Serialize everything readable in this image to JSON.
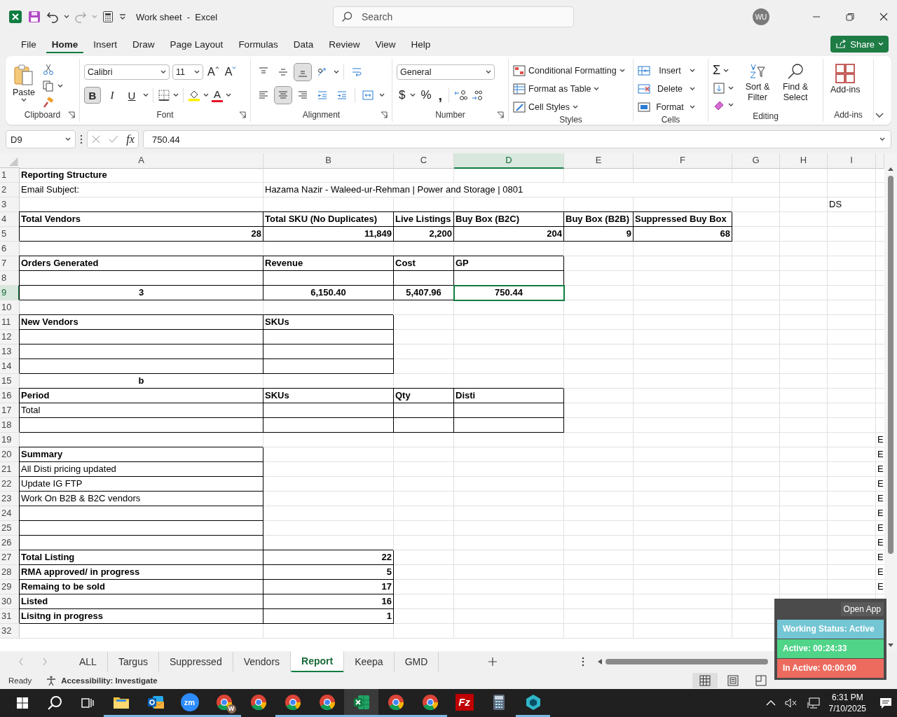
{
  "title_bar": {
    "title": "Work sheet  -  Excel",
    "search": {
      "placeholder": "Search"
    },
    "avatar": "WU"
  },
  "menu_tabs": [
    {
      "label": "File",
      "selected": false
    },
    {
      "label": "Home",
      "selected": true
    },
    {
      "label": "Insert",
      "selected": false
    },
    {
      "label": "Draw",
      "selected": false
    },
    {
      "label": "Page Layout",
      "selected": false
    },
    {
      "label": "Formulas",
      "selected": false
    },
    {
      "label": "Data",
      "selected": false
    },
    {
      "label": "Review",
      "selected": false
    },
    {
      "label": "View",
      "selected": false
    },
    {
      "label": "Help",
      "selected": false
    }
  ],
  "share": "Share",
  "ribbon": [
    {
      "kind": "clipboard",
      "label": "Clipboard",
      "paste": "Paste"
    },
    {
      "kind": "font",
      "label": "Font",
      "font": "Calibri",
      "size": "11",
      "sizers": [
        "A",
        "A"
      ],
      "styles": [
        {
          "label": "B",
          "selected": true
        },
        {
          "label": "I",
          "selected": false
        },
        {
          "label": "U",
          "selected": false
        }
      ],
      "color_letter": "A"
    },
    {
      "kind": "alignment",
      "label": "Alignment",
      "rows": [
        [
          {
            "kind": "top",
            "selected": false
          },
          {
            "kind": "middle",
            "selected": false
          },
          {
            "kind": "bottom",
            "selected": true
          },
          {
            "kind": "orientation",
            "selected": false
          },
          {
            "kind": "wrap",
            "selected": false
          }
        ],
        [
          {
            "kind": "left",
            "selected": false
          },
          {
            "kind": "center",
            "selected": true
          },
          {
            "kind": "right",
            "selected": false
          },
          {
            "kind": "outdent",
            "selected": false
          },
          {
            "kind": "indent",
            "selected": false
          },
          {
            "kind": "merge",
            "selected": false
          }
        ]
      ]
    },
    {
      "kind": "number",
      "label": "Number",
      "format": "General",
      "symbols": [
        "$",
        "%",
        ","
      ]
    },
    {
      "kind": "styles",
      "label": "Styles",
      "items": [
        "Conditional Formatting",
        "Format as Table",
        "Cell Styles"
      ]
    },
    {
      "kind": "cells",
      "label": "Cells",
      "items": [
        "Insert",
        "Delete",
        "Format"
      ]
    },
    {
      "kind": "editing",
      "label": "Editing",
      "sum": "Σ",
      "buttons": [
        "Sort & Filter",
        "Find & Select"
      ]
    },
    {
      "kind": "addins",
      "label": "Add-ins",
      "button": "Add-ins"
    }
  ],
  "formula_bar": {
    "name_box": "D9",
    "fx": "fx",
    "value": "750.44"
  },
  "columns": [
    {
      "label": "A",
      "selected": false
    },
    {
      "label": "B",
      "selected": false
    },
    {
      "label": "C",
      "selected": false
    },
    {
      "label": "D",
      "selected": true
    },
    {
      "label": "E",
      "selected": false
    },
    {
      "label": "F",
      "selected": false
    },
    {
      "label": "G",
      "selected": false
    },
    {
      "label": "H",
      "selected": false
    },
    {
      "label": "I",
      "selected": false
    }
  ],
  "rows": [
    {
      "num": "1",
      "selected": false,
      "A": {
        "text": "Reporting Structure",
        "bold": true,
        "selected": false
      }
    },
    {
      "num": "2",
      "selected": false,
      "A": {
        "text": "Email Subject:",
        "selected": false
      },
      "B": {
        "text": "Hazama Nazir - Waleed-ur-Rehman | Power and Storage | 0801",
        "overflow": true,
        "selected": false
      }
    },
    {
      "num": "3",
      "selected": false,
      "I": {
        "text": "DS",
        "selected": false
      }
    },
    {
      "num": "4",
      "selected": false,
      "A": {
        "text": "Total Vendors",
        "bold": true,
        "boxed": true,
        "selected": false
      },
      "B": {
        "text": "Total SKU (No Duplicates)",
        "bold": true,
        "boxed": true,
        "selected": false
      },
      "C": {
        "text": "Live Listings",
        "bold": true,
        "boxed": true,
        "selected": false
      },
      "D": {
        "text": "Buy Box (B2C)",
        "bold": true,
        "boxed": true,
        "selected": false
      },
      "E": {
        "text": "Buy Box (B2B)",
        "bold": true,
        "boxed": true,
        "selected": false
      },
      "F": {
        "text": "Suppressed Buy Box",
        "bold": true,
        "boxed": true,
        "selected": false
      }
    },
    {
      "num": "5",
      "selected": false,
      "A": {
        "text": "28",
        "bold": true,
        "right_aligned": true,
        "boxed": true,
        "selected": false
      },
      "B": {
        "text": "11,849",
        "bold": true,
        "right_aligned": true,
        "boxed": true,
        "selected": false
      },
      "C": {
        "text": "2,200",
        "bold": true,
        "right_aligned": true,
        "boxed": true,
        "selected": false
      },
      "D": {
        "text": "204",
        "bold": true,
        "right_aligned": true,
        "boxed": true,
        "selected": false
      },
      "E": {
        "text": "9",
        "bold": true,
        "right_aligned": true,
        "boxed": true,
        "selected": false
      },
      "F": {
        "text": "68",
        "bold": true,
        "right_aligned": true,
        "boxed": true,
        "selected": false
      }
    },
    {
      "num": "6",
      "selected": false
    },
    {
      "num": "7",
      "selected": false,
      "A": {
        "text": "Orders Generated",
        "bold": true,
        "boxed": true,
        "selected": false
      },
      "B": {
        "text": "Revenue",
        "bold": true,
        "boxed": true,
        "selected": false
      },
      "C": {
        "text": "Cost",
        "bold": true,
        "boxed": true,
        "selected": false
      },
      "D": {
        "text": "GP",
        "bold": true,
        "boxed": true,
        "selected": false
      }
    },
    {
      "num": "8",
      "selected": false,
      "A": {
        "boxed": true,
        "selected": false
      },
      "B": {
        "boxed": true,
        "selected": false
      },
      "C": {
        "boxed": true,
        "selected": false
      },
      "D": {
        "boxed": true,
        "selected": false
      }
    },
    {
      "num": "9",
      "selected": true,
      "A": {
        "text": "3",
        "bold": true,
        "centered": true,
        "boxed": true,
        "selected": false
      },
      "B": {
        "text": "6,150.40",
        "bold": true,
        "centered": true,
        "boxed": true,
        "selected": false
      },
      "C": {
        "text": "5,407.96",
        "bold": true,
        "centered": true,
        "boxed": true,
        "selected": false
      },
      "D": {
        "text": "750.44",
        "bold": true,
        "centered": true,
        "boxed": true,
        "selected": true
      }
    },
    {
      "num": "10",
      "selected": false
    },
    {
      "num": "11",
      "selected": false,
      "A": {
        "text": "New Vendors",
        "bold": true,
        "boxed": true,
        "selected": false
      },
      "B": {
        "text": "SKUs",
        "bold": true,
        "boxed": true,
        "selected": false
      }
    },
    {
      "num": "12",
      "selected": false,
      "A": {
        "boxed": true,
        "selected": false
      },
      "B": {
        "boxed": true,
        "selected": false
      }
    },
    {
      "num": "13",
      "selected": false,
      "A": {
        "boxed": true,
        "selected": false
      },
      "B": {
        "boxed": true,
        "selected": false
      }
    },
    {
      "num": "14",
      "selected": false,
      "A": {
        "boxed": true,
        "selected": false
      },
      "B": {
        "boxed": true,
        "selected": false
      }
    },
    {
      "num": "15",
      "selected": false,
      "A": {
        "text": "b",
        "bold": true,
        "centered": true,
        "selected": false
      }
    },
    {
      "num": "16",
      "selected": false,
      "A": {
        "text": "Period",
        "bold": true,
        "boxed": true,
        "selected": false
      },
      "B": {
        "text": "SKUs",
        "bold": true,
        "boxed": true,
        "selected": false
      },
      "C": {
        "text": "Qty",
        "bold": true,
        "boxed": true,
        "selected": false
      },
      "D": {
        "text": "Disti",
        "bold": true,
        "boxed": true,
        "selected": false
      }
    },
    {
      "num": "17",
      "selected": false,
      "A": {
        "text": "Total",
        "boxed": true,
        "selected": false
      },
      "B": {
        "boxed": true,
        "selected": false
      },
      "C": {
        "boxed": true,
        "selected": false
      },
      "D": {
        "boxed": true,
        "selected": false
      }
    },
    {
      "num": "18",
      "selected": false,
      "A": {
        "boxed": true,
        "selected": false
      },
      "B": {
        "boxed": true,
        "selected": false
      },
      "C": {
        "boxed": true,
        "selected": false
      },
      "D": {
        "boxed": true,
        "selected": false
      }
    },
    {
      "num": "19",
      "selected": false,
      "J": {
        "text": "E",
        "selected": false
      }
    },
    {
      "num": "20",
      "selected": false,
      "A": {
        "text": "Summary",
        "bold": true,
        "boxed": true,
        "selected": false
      },
      "J": {
        "text": "E",
        "selected": false
      }
    },
    {
      "num": "21",
      "selected": false,
      "A": {
        "text": "All Disti pricing updated",
        "boxed": true,
        "selected": false
      },
      "J": {
        "text": "E",
        "selected": false
      }
    },
    {
      "num": "22",
      "selected": false,
      "A": {
        "text": "Update IG FTP",
        "boxed": true,
        "selected": false
      },
      "J": {
        "text": "E",
        "selected": false
      }
    },
    {
      "num": "23",
      "selected": false,
      "A": {
        "text": "Work On B2B & B2C vendors",
        "boxed": true,
        "selected": false
      },
      "J": {
        "text": "E",
        "selected": false
      }
    },
    {
      "num": "24",
      "selected": false,
      "A": {
        "boxed": true,
        "selected": false
      },
      "J": {
        "text": "E",
        "selected": false
      }
    },
    {
      "num": "25",
      "selected": false,
      "A": {
        "boxed": true,
        "selected": false
      },
      "J": {
        "text": "E",
        "selected": false
      }
    },
    {
      "num": "26",
      "selected": false,
      "A": {
        "boxed": true,
        "selected": false
      },
      "J": {
        "text": "E",
        "selected": false
      }
    },
    {
      "num": "27",
      "selected": false,
      "A": {
        "text": "Total Listing",
        "bold": true,
        "boxed": true,
        "selected": false
      },
      "B": {
        "text": "22",
        "bold": true,
        "right_aligned": true,
        "boxed": true,
        "selected": false
      },
      "J": {
        "text": "E",
        "selected": false
      }
    },
    {
      "num": "28",
      "selected": false,
      "A": {
        "text": "RMA approved/ in progress",
        "bold": true,
        "boxed": true,
        "selected": false
      },
      "B": {
        "text": "5",
        "bold": true,
        "right_aligned": true,
        "boxed": true,
        "selected": false
      },
      "J": {
        "text": "E",
        "selected": false
      }
    },
    {
      "num": "29",
      "selected": false,
      "A": {
        "text": "Remaing to be sold",
        "bold": true,
        "boxed": true,
        "selected": false
      },
      "B": {
        "text": "17",
        "bold": true,
        "right_aligned": true,
        "boxed": true,
        "selected": false
      },
      "J": {
        "text": "E",
        "selected": false
      }
    },
    {
      "num": "30",
      "selected": false,
      "A": {
        "text": "Listed",
        "bold": true,
        "boxed": true,
        "selected": false
      },
      "B": {
        "text": "16",
        "bold": true,
        "right_aligned": true,
        "boxed": true,
        "selected": false
      }
    },
    {
      "num": "31",
      "selected": false,
      "A": {
        "text": "Lisitng in progress",
        "bold": true,
        "boxed": true,
        "selected": false
      },
      "B": {
        "text": "1",
        "bold": true,
        "right_aligned": true,
        "boxed": true,
        "selected": false
      }
    },
    {
      "num": "32",
      "selected": false
    }
  ],
  "sheet_tabs": [
    {
      "label": "ALL",
      "selected": false
    },
    {
      "label": "Targus",
      "selected": false
    },
    {
      "label": "Suppressed",
      "selected": false
    },
    {
      "label": "Vendors",
      "selected": false
    },
    {
      "label": "Report",
      "selected": true
    },
    {
      "label": "Keepa",
      "selected": false
    },
    {
      "label": "GMD",
      "selected": false
    }
  ],
  "status_bar": {
    "ready": "Ready",
    "accessibility": "Accessibility: Investigate",
    "views": [
      {
        "kind": "normal",
        "selected": true
      },
      {
        "kind": "page-layout",
        "selected": false
      },
      {
        "kind": "page-break",
        "selected": false
      }
    ]
  },
  "tracker": {
    "open": "Open App",
    "rows": [
      {
        "text": "Working Status: Active",
        "color": "#74c6d4"
      },
      {
        "text": "Active: 00:24:33",
        "color": "#4fd488"
      },
      {
        "text": "In Active: 00:00:00",
        "color": "#ec6b5e"
      }
    ]
  },
  "taskbar": {
    "apps": [
      {
        "kind": "explorer",
        "running": true,
        "selected": false
      },
      {
        "kind": "outlook",
        "running": true,
        "selected": false
      },
      {
        "kind": "zoom",
        "label": "zm",
        "running": true,
        "selected": false
      },
      {
        "kind": "chrome",
        "badge": "W",
        "running": true,
        "selected": false
      },
      {
        "kind": "chrome",
        "running": false,
        "selected": false
      },
      {
        "kind": "chrome",
        "running": true,
        "selected": false
      },
      {
        "kind": "chrome",
        "running": true,
        "selected": false
      },
      {
        "kind": "excel",
        "running": true,
        "selected": true
      },
      {
        "kind": "chrome",
        "running": true,
        "selected": false
      },
      {
        "kind": "chrome",
        "running": true,
        "selected": false
      },
      {
        "kind": "filezilla",
        "label": "Fz",
        "running": false,
        "selected": false
      },
      {
        "kind": "calculator",
        "running": false,
        "selected": false
      },
      {
        "kind": "app",
        "running": true,
        "selected": false
      }
    ],
    "time": "6:31 PM",
    "date": "7/10/2025"
  }
}
